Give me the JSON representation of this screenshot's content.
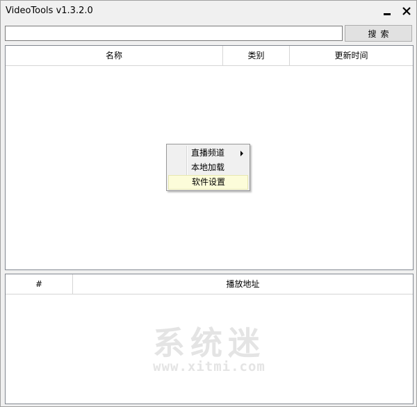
{
  "window": {
    "title": "VideoTools v1.3.2.0",
    "minimize_icon": "minimize-icon",
    "close_icon": "close-icon",
    "close_glyph": "✕"
  },
  "search": {
    "value": "",
    "placeholder": "",
    "button_label": "搜索"
  },
  "channel_table": {
    "columns": [
      "名称",
      "类别",
      "更新时间"
    ],
    "rows": []
  },
  "context_menu": {
    "items": [
      {
        "label": "直播频道",
        "has_submenu": true,
        "highlighted": false
      },
      {
        "label": "本地加载",
        "has_submenu": false,
        "highlighted": false
      },
      {
        "label": "软件设置",
        "has_submenu": false,
        "highlighted": true
      }
    ]
  },
  "url_table": {
    "columns": [
      "#",
      "播放地址"
    ],
    "rows": []
  },
  "watermark": {
    "main": "系统迷",
    "sub": "www.xitmi.com"
  },
  "colors": {
    "window_bg": "#f0f0f0",
    "grid_bg": "#ffffff",
    "menu_highlight": "#fcfcd9",
    "watermark": "#e4e4e4"
  }
}
